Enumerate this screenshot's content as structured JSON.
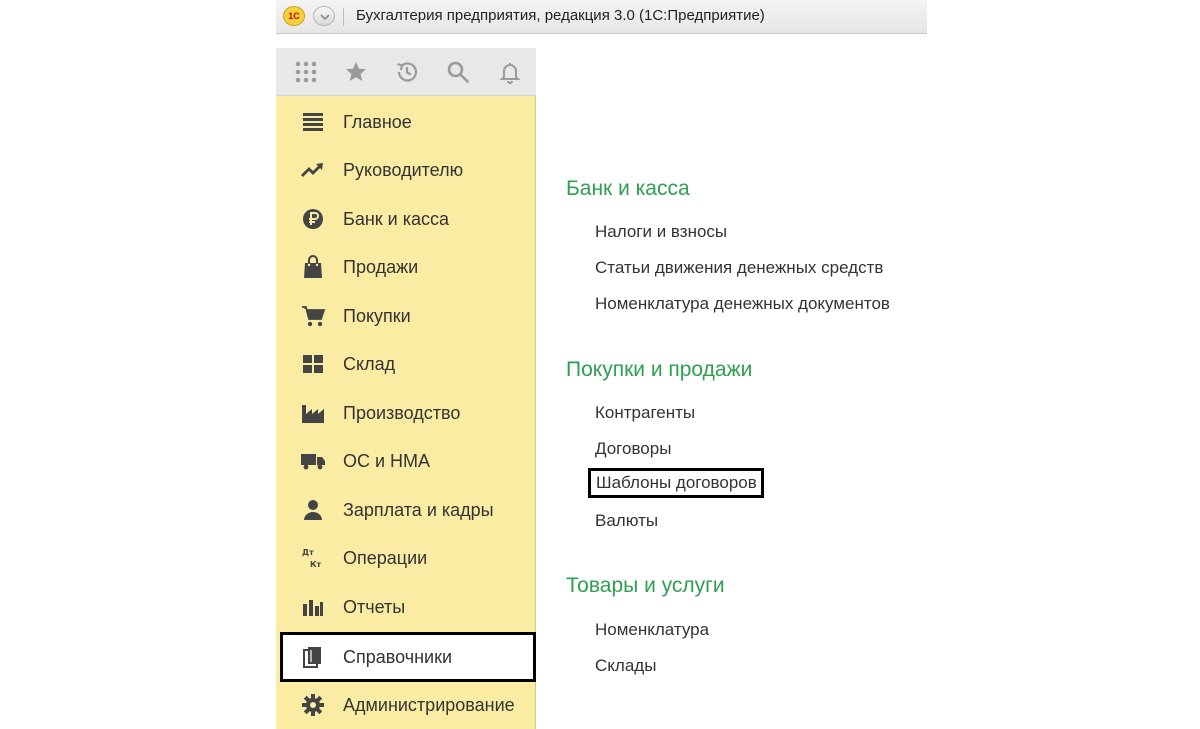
{
  "window": {
    "logo_text": "1С",
    "title": "Бухгалтерия предприятия, редакция 3.0  (1С:Предприятие)"
  },
  "toolbar": {
    "icons": [
      "apps-grid-icon",
      "favorites-star-icon",
      "history-icon",
      "search-icon",
      "notifications-bell-icon"
    ]
  },
  "sidebar": {
    "items": [
      {
        "label": "Главное",
        "icon": "menu-lines-icon"
      },
      {
        "label": "Руководителю",
        "icon": "trend-chart-icon"
      },
      {
        "label": "Банк и касса",
        "icon": "ruble-coin-icon"
      },
      {
        "label": "Продажи",
        "icon": "shopping-bag-icon"
      },
      {
        "label": "Покупки",
        "icon": "cart-icon"
      },
      {
        "label": "Склад",
        "icon": "warehouse-icon"
      },
      {
        "label": "Производство",
        "icon": "factory-icon"
      },
      {
        "label": "ОС и НМА",
        "icon": "truck-icon"
      },
      {
        "label": "Зарплата и кадры",
        "icon": "person-icon"
      },
      {
        "label": "Операции",
        "icon": "debit-credit-icon"
      },
      {
        "label": "Отчеты",
        "icon": "bar-chart-icon"
      },
      {
        "label": "Справочники",
        "icon": "books-icon",
        "selected": true
      },
      {
        "label": "Администрирование",
        "icon": "gear-icon"
      }
    ],
    "debit_credit_glyph": {
      "top": "Дт",
      "bottom": "Кт"
    }
  },
  "content": {
    "sections": [
      {
        "title": "Банк и касса",
        "links": [
          "Налоги и взносы",
          "Статьи движения денежных средств",
          "Номенклатура денежных документов"
        ]
      },
      {
        "title": "Покупки и продажи",
        "links": [
          "Контрагенты",
          "Договоры",
          "Шаблоны договоров",
          "Валюты"
        ]
      },
      {
        "title": "Товары и услуги",
        "links": [
          "Номенклатура",
          "Склады"
        ]
      }
    ],
    "highlighted_link": "Шаблоны договоров"
  },
  "colors": {
    "sidebar_bg": "#fbeca3",
    "section_title": "#2e9f50",
    "highlight_border": "#000000"
  }
}
